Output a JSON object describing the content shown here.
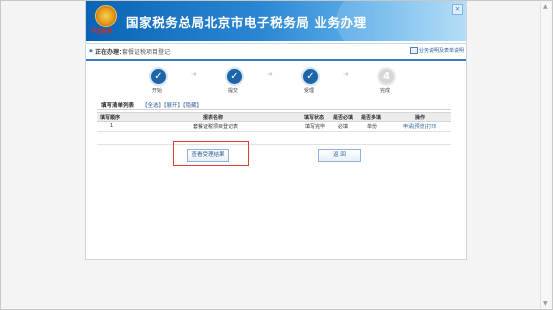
{
  "header": {
    "emblem_text": "中国税务",
    "title": "国家税务总局北京市电子税务局  业务办理",
    "close_glyph": "×"
  },
  "breadcrumb": {
    "label": "正在办理：",
    "value": "套餐证税项目登记",
    "help_link": "业务说明及表单说明"
  },
  "steps": [
    {
      "label": "开始",
      "state": "done",
      "symbol": "✓"
    },
    {
      "label": "提交",
      "state": "done",
      "symbol": "✓"
    },
    {
      "label": "受理",
      "state": "done",
      "symbol": "✓"
    },
    {
      "label": "完成",
      "state": "pending",
      "symbol": "4"
    }
  ],
  "arrow_glyph": "➜",
  "list": {
    "title": "填写清单列表",
    "actions": [
      "【全选】",
      "【展开】",
      "【隐藏】"
    ],
    "columns": [
      "填写顺序",
      "报表名称",
      "填写状态",
      "是否必填",
      "是否多填",
      "操作"
    ],
    "rows": [
      {
        "order": "1",
        "name": "套餐证税项目登记表",
        "status": "填写完毕",
        "required": "必填",
        "multi": "单份",
        "operation": "申请|预览|打印"
      }
    ]
  },
  "buttons": {
    "result": "查看受理结果",
    "back": "返 回"
  },
  "colors": {
    "accent": "#1d64a8",
    "highlight": "#e53935",
    "link": "#2c5d97"
  }
}
